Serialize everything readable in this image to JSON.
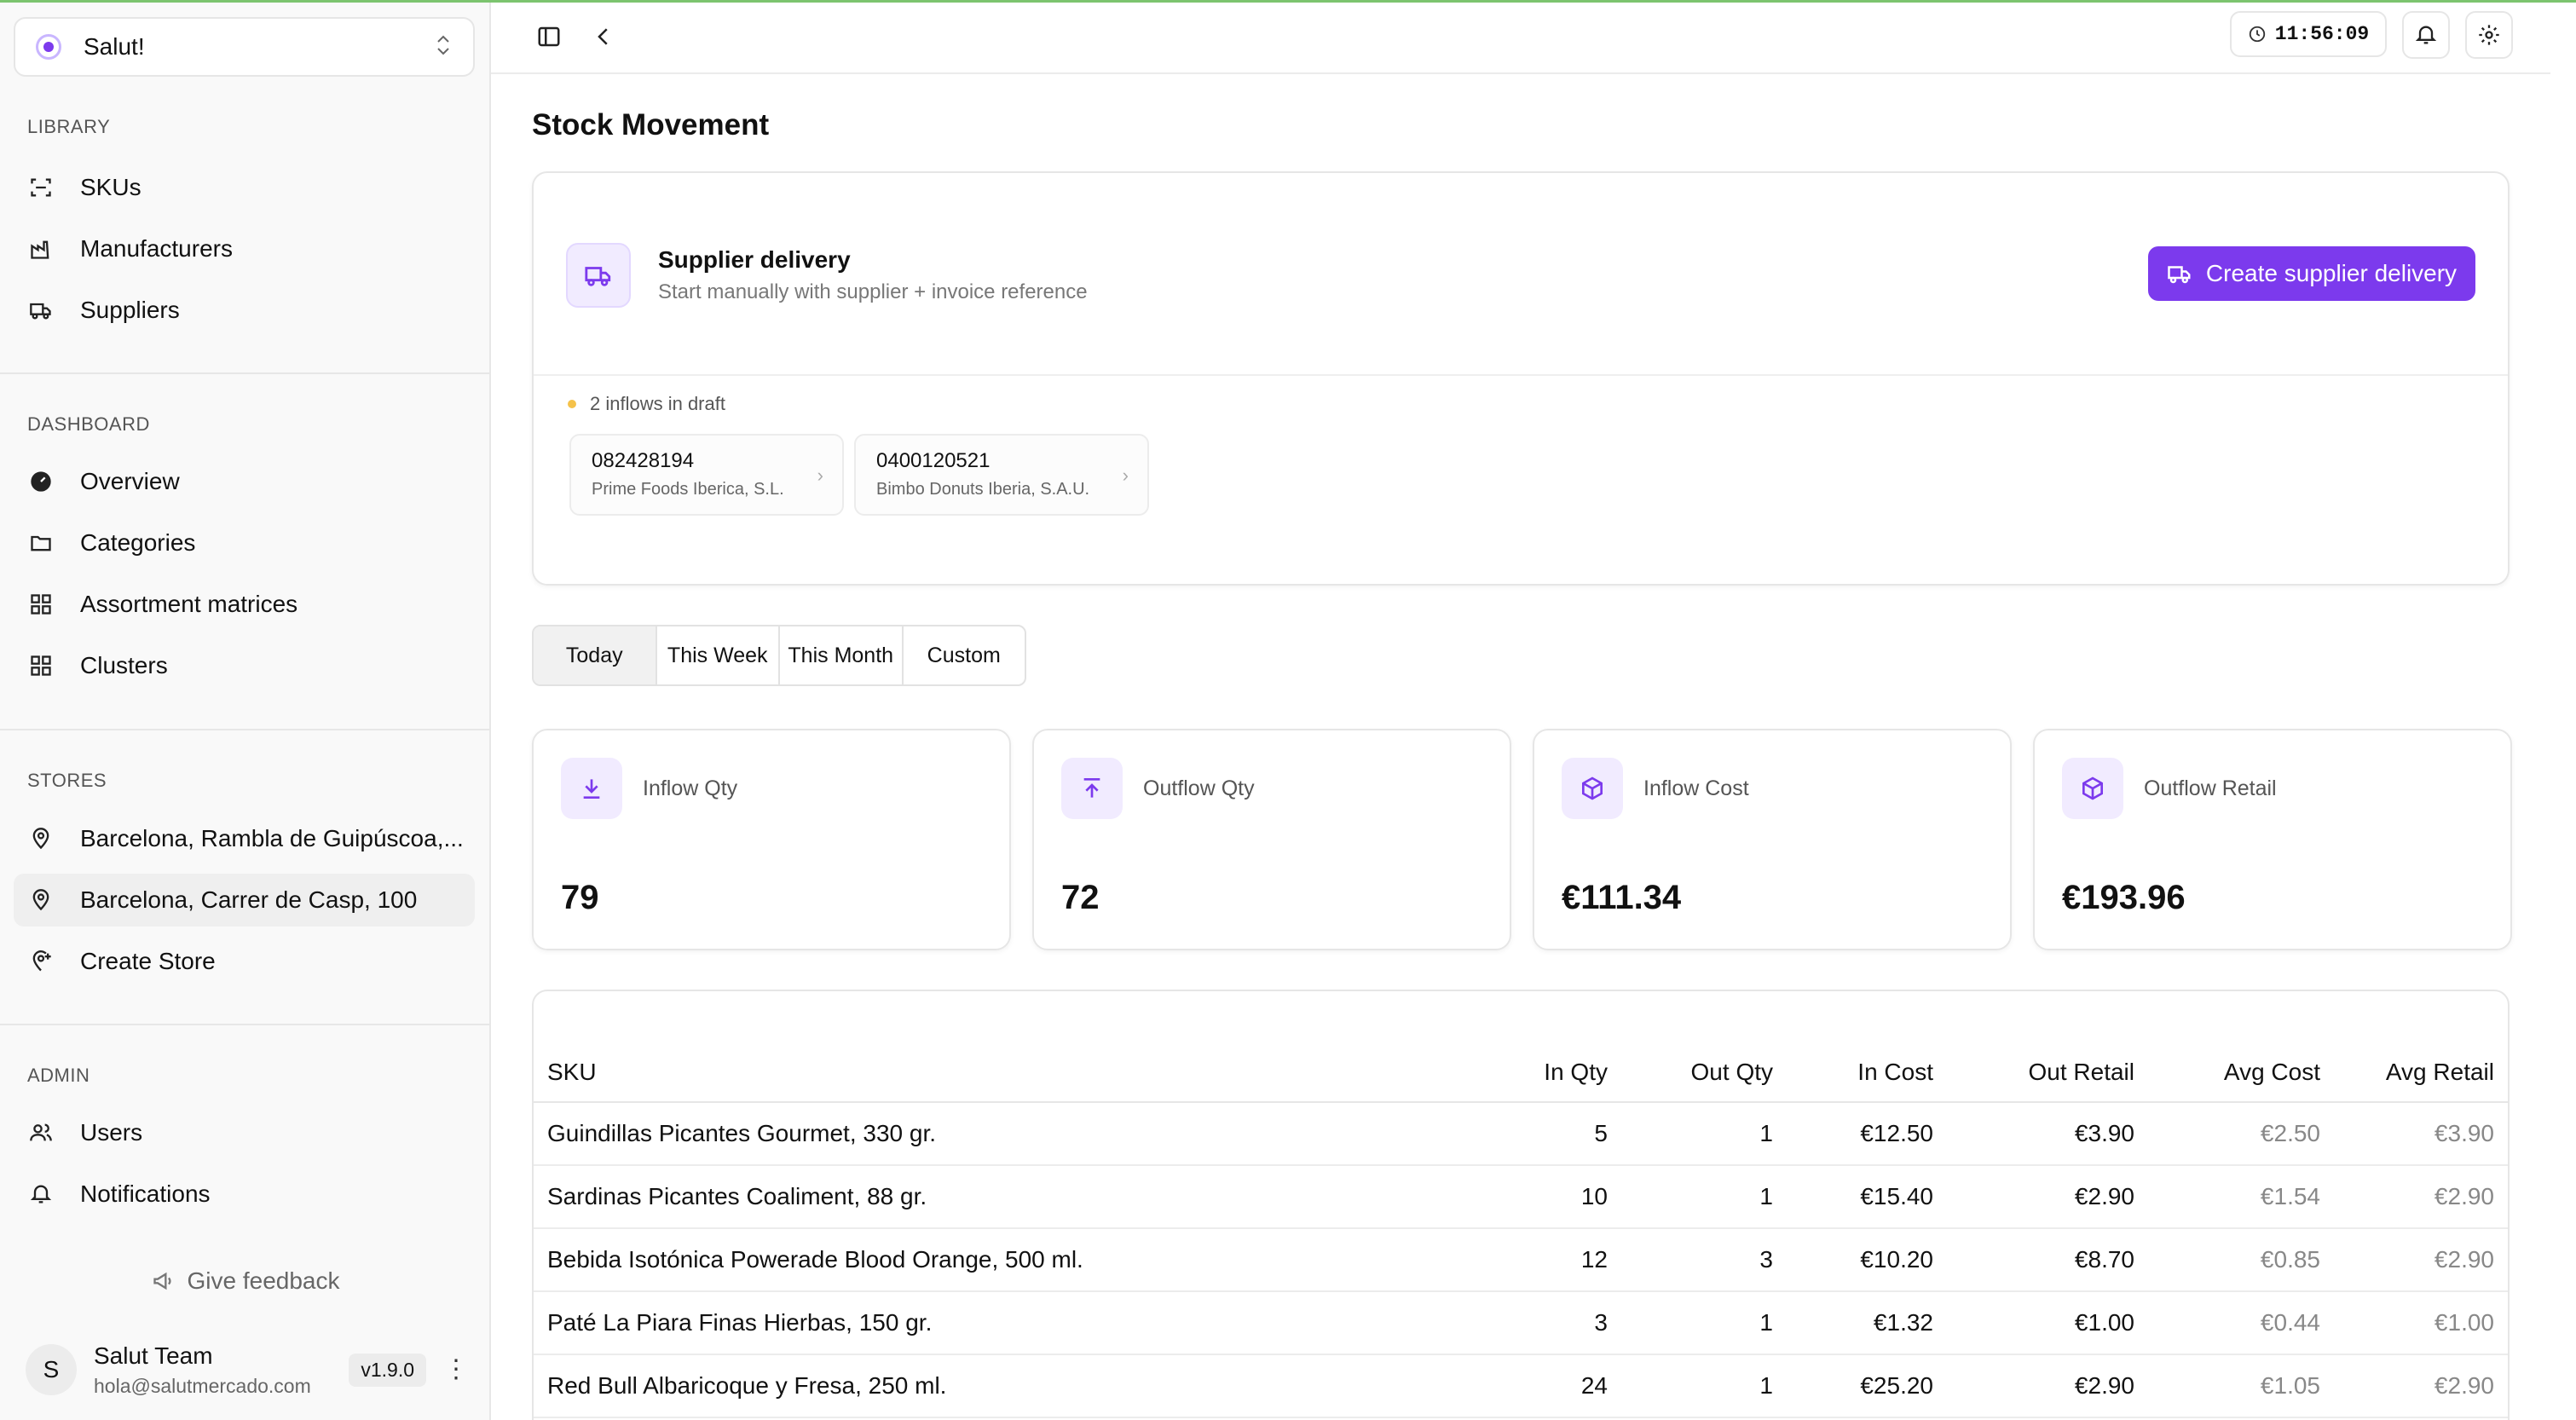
{
  "workspace": {
    "name": "Salut!"
  },
  "sidebar": {
    "library_label": "LIBRARY",
    "library": [
      {
        "label": "SKUs",
        "icon": "scan-icon"
      },
      {
        "label": "Manufacturers",
        "icon": "factory-icon"
      },
      {
        "label": "Suppliers",
        "icon": "truck-icon"
      }
    ],
    "dashboard_label": "DASHBOARD",
    "dashboard": [
      {
        "label": "Overview",
        "icon": "gauge-icon"
      },
      {
        "label": "Categories",
        "icon": "folder-icon"
      },
      {
        "label": "Assortment matrices",
        "icon": "grid-icon"
      },
      {
        "label": "Clusters",
        "icon": "grid-icon"
      }
    ],
    "stores_label": "STORES",
    "stores": [
      {
        "label": "Barcelona, Rambla de Guipúscoa,...",
        "icon": "map-pin-icon"
      },
      {
        "label": "Barcelona, Carrer de Casp, 100",
        "icon": "map-pin-icon"
      },
      {
        "label": "Create Store",
        "icon": "map-pin-plus-icon"
      }
    ],
    "admin_label": "ADMIN",
    "admin": [
      {
        "label": "Users",
        "icon": "users-icon"
      },
      {
        "label": "Notifications",
        "icon": "bell-icon"
      }
    ],
    "feedback_label": "Give feedback",
    "user": {
      "initial": "S",
      "name": "Salut Team",
      "email": "hola@salutmercado.com",
      "version": "v1.9.0"
    }
  },
  "topbar": {
    "time": "11:56:09"
  },
  "page": {
    "title": "Stock Movement"
  },
  "delivery": {
    "title": "Supplier delivery",
    "subtitle": "Start manually with supplier + invoice reference",
    "button_label": "Create supplier delivery",
    "draft_note": "2 inflows in draft",
    "drafts": [
      {
        "number": "082428194",
        "supplier": "Prime Foods Iberica, S.L."
      },
      {
        "number": "0400120521",
        "supplier": "Bimbo Donuts Iberia, S.A.U."
      }
    ]
  },
  "ranges": [
    "Today",
    "This Week",
    "This Month",
    "Custom"
  ],
  "stats": [
    {
      "label": "Inflow Qty",
      "value": "79",
      "icon": "download-icon"
    },
    {
      "label": "Outflow Qty",
      "value": "72",
      "icon": "upload-icon"
    },
    {
      "label": "Inflow Cost",
      "value": "€111.34",
      "icon": "package-icon"
    },
    {
      "label": "Outflow Retail",
      "value": "€193.96",
      "icon": "package-icon"
    }
  ],
  "table": {
    "columns": [
      "SKU",
      "In Qty",
      "Out Qty",
      "In Cost",
      "Out Retail",
      "Avg Cost",
      "Avg Retail"
    ],
    "rows": [
      [
        "Guindillas Picantes Gourmet, 330 gr.",
        "5",
        "1",
        "€12.50",
        "€3.90",
        "€2.50",
        "€3.90"
      ],
      [
        "Sardinas Picantes Coaliment, 88 gr.",
        "10",
        "1",
        "€15.40",
        "€2.90",
        "€1.54",
        "€2.90"
      ],
      [
        "Bebida Isotónica Powerade Blood Orange, 500 ml.",
        "12",
        "3",
        "€10.20",
        "€8.70",
        "€0.85",
        "€2.90"
      ],
      [
        "Paté La Piara Finas Hierbas, 150 gr.",
        "3",
        "1",
        "€1.32",
        "€1.00",
        "€0.44",
        "€1.00"
      ],
      [
        "Red Bull Albaricoque y Fresa, 250 ml.",
        "24",
        "1",
        "€25.20",
        "€2.90",
        "€1.05",
        "€2.90"
      ]
    ]
  }
}
